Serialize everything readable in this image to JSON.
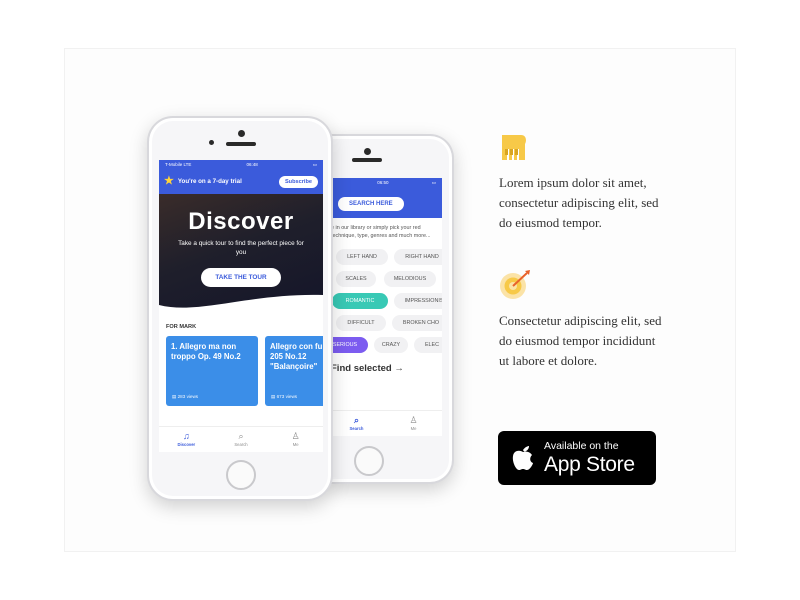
{
  "front_phone": {
    "status": {
      "carrier": "T-Mobile  LTE",
      "time": "06:48"
    },
    "trial_text": "You're on a 7-day trial",
    "subscribe_label": "Subscribe",
    "hero": {
      "title": "Discover",
      "subtitle": "Take a quick tour to find the perfect piece for you",
      "tour_button": "TAKE THE TOUR"
    },
    "section_label": "FOR MARK",
    "pieces": [
      {
        "title": "1. Allegro ma non troppo Op. 49 No.2",
        "views": "283 views"
      },
      {
        "title": "Allegro con fu Op. 205 No.12 \"Balançoire\"",
        "views": "673 views"
      }
    ],
    "tabs": [
      {
        "label": "Discover",
        "icon": "music-note-icon"
      },
      {
        "label": "Search",
        "icon": "search-icon"
      },
      {
        "label": "Me",
        "icon": "person-icon"
      }
    ]
  },
  "back_phone": {
    "status_time": "06:50",
    "search_button": "SEARCH HERE",
    "hint": "e in our library or simply pick your red technique, type, genres and much more...",
    "chips": [
      {
        "label": "LEFT HAND"
      },
      {
        "label": "RIGHT HAND"
      },
      {
        "label": "SCALES"
      },
      {
        "label": "MELODIOUS"
      },
      {
        "label": "ROMANTIC"
      },
      {
        "label": "IMPRESSIONIS"
      },
      {
        "label": "DIFFICULT"
      },
      {
        "label": "BROKEN CHO"
      },
      {
        "label": "SERIOUS"
      },
      {
        "label": "CRAZY"
      },
      {
        "label": "ELEC"
      }
    ],
    "find_selected": "Find selected",
    "tabs": [
      {
        "label": "Search",
        "icon": "search-icon"
      },
      {
        "label": "Me",
        "icon": "person-icon"
      }
    ]
  },
  "features": [
    {
      "icon": "piano-icon",
      "text": "Lorem ipsum dolor sit amet, consectetur adipiscing elit, sed do eiusmod tempor."
    },
    {
      "icon": "target-icon",
      "text": "Consectetur adipiscing elit, sed do eiusmod tempor incididunt ut labore et dolore."
    }
  ],
  "app_store": {
    "line1": "Available on the",
    "line2": "App Store",
    "icon": "apple-icon"
  },
  "colors": {
    "brand_blue": "#3b5bdb",
    "card_blue": "#3b8ee8",
    "accent_yellow": "#f7c948",
    "chip_teal": "#38c9b5",
    "chip_purple": "#7c5cf0"
  }
}
